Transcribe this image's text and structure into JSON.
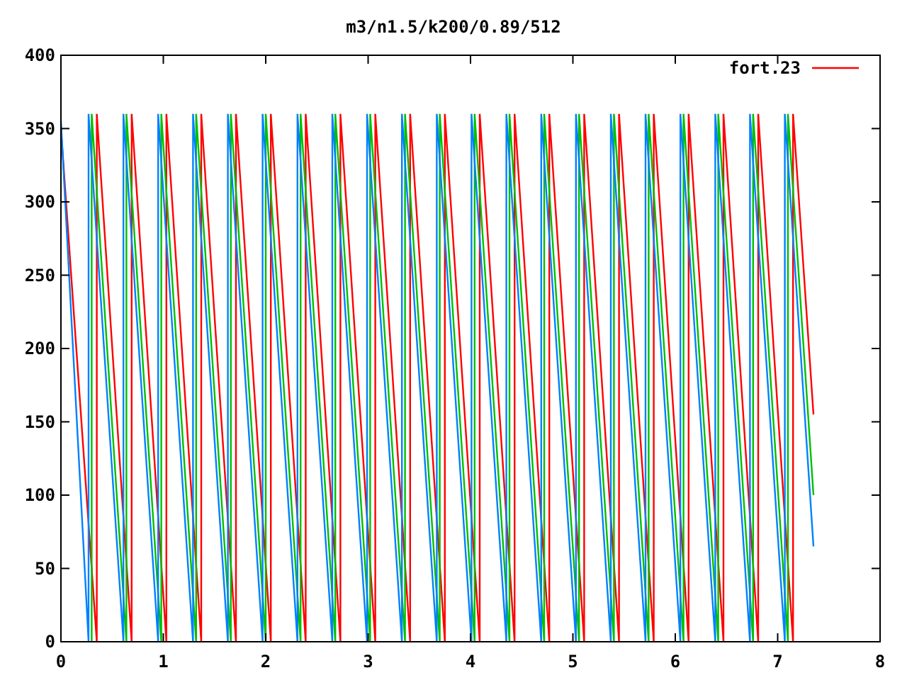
{
  "chart_data": {
    "type": "line",
    "title": "m3/n1.5/k200/0.89/512",
    "xlim": [
      0,
      8
    ],
    "ylim": [
      0,
      400
    ],
    "xticks": [
      0,
      1,
      2,
      3,
      4,
      5,
      6,
      7,
      8
    ],
    "yticks": [
      0,
      50,
      100,
      150,
      200,
      250,
      300,
      350,
      400
    ],
    "series": [
      {
        "name": "fort.23",
        "color": "#ff0000",
        "x": [
          0,
          0.35,
          0.35,
          0.69,
          0.69,
          1.03,
          1.03,
          1.37,
          1.37,
          1.71,
          1.71,
          2.05,
          2.05,
          2.39,
          2.39,
          2.73,
          2.73,
          3.07,
          3.07,
          3.41,
          3.41,
          3.75,
          3.75,
          4.09,
          4.09,
          4.43,
          4.43,
          4.77,
          4.77,
          5.11,
          5.11,
          5.45,
          5.45,
          5.79,
          5.79,
          6.13,
          6.13,
          6.47,
          6.47,
          6.81,
          6.81,
          7.15,
          7.15,
          7.35
        ],
        "values": [
          350,
          0,
          360,
          0,
          360,
          0,
          360,
          0,
          360,
          0,
          360,
          0,
          360,
          0,
          360,
          0,
          360,
          0,
          360,
          0,
          360,
          0,
          360,
          0,
          360,
          0,
          360,
          0,
          360,
          0,
          360,
          0,
          360,
          0,
          360,
          0,
          360,
          0,
          360,
          0,
          360,
          0,
          360,
          155
        ]
      },
      {
        "color": "#00c000",
        "x": [
          0.3,
          0.3,
          0.64,
          0.64,
          0.98,
          0.98,
          1.32,
          1.32,
          1.66,
          1.66,
          2.0,
          2.0,
          2.34,
          2.34,
          2.68,
          2.68,
          3.02,
          3.02,
          3.36,
          3.36,
          3.7,
          3.7,
          4.04,
          4.04,
          4.38,
          4.38,
          4.72,
          4.72,
          5.06,
          5.06,
          5.4,
          5.4,
          5.74,
          5.74,
          6.08,
          6.08,
          6.42,
          6.42,
          6.76,
          6.76,
          7.1,
          7.1,
          7.35
        ],
        "values": [
          0,
          360,
          0,
          360,
          0,
          360,
          0,
          360,
          0,
          360,
          0,
          360,
          0,
          360,
          0,
          360,
          0,
          360,
          0,
          360,
          0,
          360,
          0,
          360,
          0,
          360,
          0,
          360,
          0,
          360,
          0,
          360,
          0,
          360,
          0,
          360,
          0,
          360,
          0,
          360,
          0,
          360,
          100
        ]
      },
      {
        "color": "#0080ff",
        "x": [
          0,
          0.27,
          0.27,
          0.61,
          0.61,
          0.95,
          0.95,
          1.29,
          1.29,
          1.63,
          1.63,
          1.97,
          1.97,
          2.31,
          2.31,
          2.65,
          2.65,
          2.99,
          2.99,
          3.33,
          3.33,
          3.67,
          3.67,
          4.01,
          4.01,
          4.35,
          4.35,
          4.69,
          4.69,
          5.03,
          5.03,
          5.37,
          5.37,
          5.71,
          5.71,
          6.05,
          6.05,
          6.39,
          6.39,
          6.73,
          6.73,
          7.07,
          7.07,
          7.35
        ],
        "values": [
          355,
          0,
          360,
          0,
          360,
          0,
          360,
          0,
          360,
          0,
          360,
          0,
          360,
          0,
          360,
          0,
          360,
          0,
          360,
          0,
          360,
          0,
          360,
          0,
          360,
          0,
          360,
          0,
          360,
          0,
          360,
          0,
          360,
          0,
          360,
          0,
          360,
          0,
          360,
          0,
          360,
          0,
          360,
          65
        ]
      }
    ]
  }
}
